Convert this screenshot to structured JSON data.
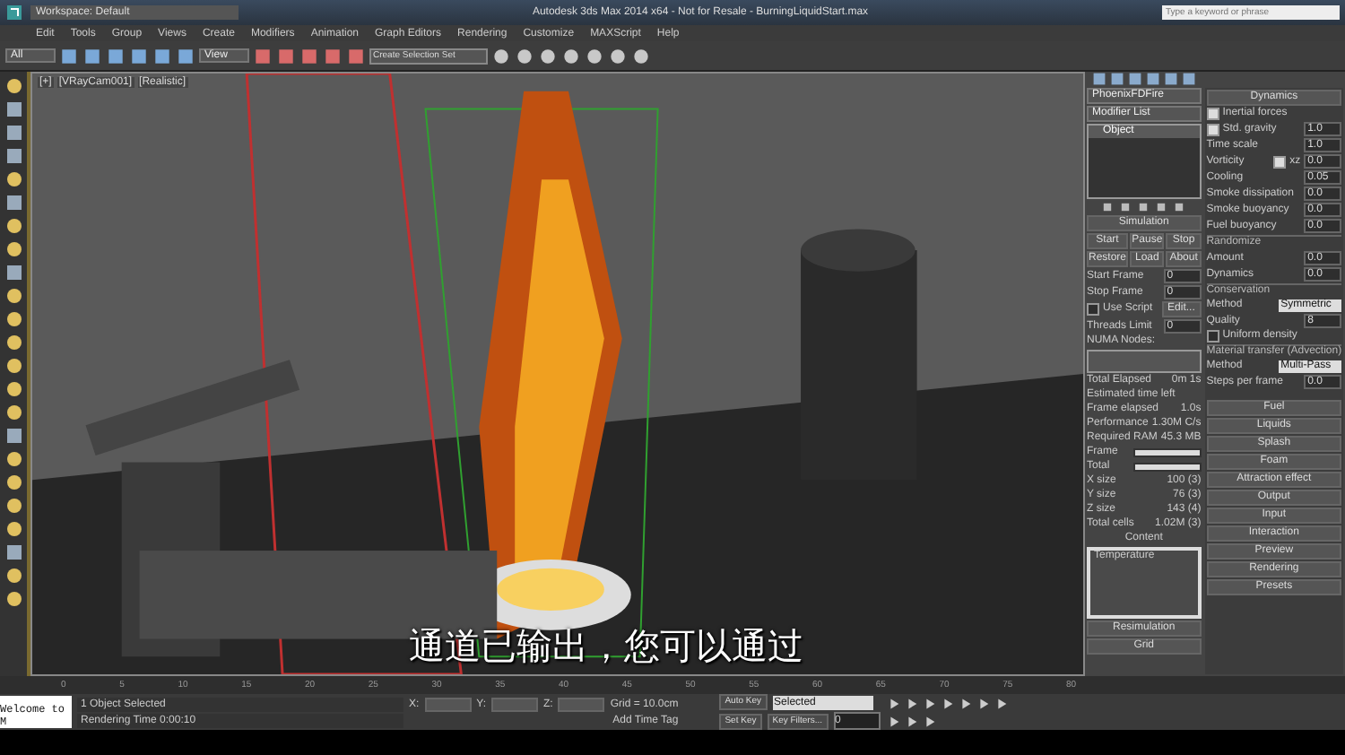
{
  "title_bar": {
    "workspace": "Workspace: Default",
    "title": "Autodesk 3ds Max 2014 x64 - Not for Resale - BurningLiquidStart.max",
    "search": {
      "placeholder": "Type a keyword or phrase"
    }
  },
  "menu": [
    "Edit",
    "Tools",
    "Group",
    "Views",
    "Create",
    "Modifiers",
    "Animation",
    "Graph Editors",
    "Rendering",
    "Customize",
    "MAXScript",
    "Help"
  ],
  "toolbar": {
    "selection_filter": "All",
    "reference_coord": "View",
    "selection_set": {
      "placeholder": "Create Selection Set"
    }
  },
  "viewport": {
    "labels": [
      "[+]",
      "[VRayCam001]",
      "[Realistic]"
    ],
    "subtitle": "通道已输出，您可以通过"
  },
  "modify_panel": {
    "object_name": "PhoenixFDFire",
    "modifier_list": "Modifier List",
    "stack": [
      {
        "label": "Object",
        "selected": true
      }
    ]
  },
  "simulation": {
    "title": "Simulation",
    "buttons": [
      "Start",
      "Pause",
      "Stop",
      "Restore",
      "Load",
      "About"
    ],
    "frames": [
      {
        "label": "Start Frame",
        "value": "0"
      },
      {
        "label": "Stop Frame",
        "value": "0"
      }
    ],
    "use_script": {
      "label": "Use Script",
      "checked": false
    },
    "edit_button": "Edit...",
    "threads": {
      "label": "Threads Limit",
      "value": "0"
    },
    "numa_label": "NUMA Nodes:",
    "stats": [
      {
        "label": "Total Elapsed",
        "value": "0m 1s"
      },
      {
        "label": "Estimated time left"
      },
      {
        "label": "Frame elapsed",
        "value": "1.0s"
      },
      {
        "label": "Performance",
        "value": "1.30M C/s"
      },
      {
        "label": "Required RAM",
        "value": "45.3 MB"
      }
    ],
    "progress": [
      {
        "label": "Frame",
        "level": 1
      },
      {
        "label": "Total",
        "level": 1
      }
    ],
    "sizes": [
      {
        "label": "X size",
        "value": "100 (3)"
      },
      {
        "label": "Y size",
        "value": "76 (3)"
      },
      {
        "label": "Z size",
        "value": "143 (4)"
      },
      {
        "label": "Total cells",
        "value": "1.02M (3)"
      }
    ],
    "content_label": "Content",
    "content_items": [
      {
        "label": "Temperature",
        "selected": false
      }
    ]
  },
  "panel_rollouts": [
    "Resimulation",
    "Grid"
  ],
  "dynamics": {
    "title": "Dynamics",
    "rows": [
      {
        "kind": "check",
        "label": "Inertial forces",
        "checked": true
      },
      {
        "kind": "check_spin",
        "label": "Std. gravity",
        "checked": true,
        "value": "1.0"
      },
      {
        "kind": "spin",
        "label": "Time scale",
        "value": "1.0"
      },
      {
        "kind": "spin_check",
        "label": "Vorticity",
        "check_label": "xz",
        "checked": true,
        "value": "0.0"
      },
      {
        "kind": "spin",
        "label": "Cooling",
        "value": "0.05"
      },
      {
        "kind": "spin",
        "label": "Smoke dissipation",
        "value": "0.0"
      },
      {
        "kind": "spin",
        "label": "Smoke buoyancy",
        "value": "0.0"
      },
      {
        "kind": "spin",
        "label": "Fuel buoyancy",
        "value": "0.0"
      },
      {
        "kind": "group",
        "label": "Randomize"
      },
      {
        "kind": "spin",
        "label": "Amount",
        "value": "0.0"
      },
      {
        "kind": "spin",
        "label": "Dynamics",
        "value": "0.0"
      },
      {
        "kind": "group",
        "label": "Conservation"
      },
      {
        "kind": "dropdown",
        "label": "Method",
        "value": "Symmetric"
      },
      {
        "kind": "spin",
        "label": "Quality",
        "value": "8"
      },
      {
        "kind": "check",
        "label": "Uniform density",
        "checked": false
      },
      {
        "kind": "group",
        "label": "Material transfer (Advection)"
      },
      {
        "kind": "dropdown",
        "label": "Method",
        "value": "Multi-Pass"
      },
      {
        "kind": "spin",
        "label": "Steps per frame",
        "value": "0.0"
      }
    ]
  },
  "rollouts": [
    "Fuel",
    "Liquids",
    "Splash",
    "Foam",
    "Attraction effect",
    "Output",
    "Input",
    "Interaction",
    "Preview",
    "Rendering",
    "Presets"
  ],
  "timeline": {
    "ticks": [
      "0",
      "5",
      "10",
      "15",
      "20",
      "25",
      "30",
      "35",
      "40",
      "45",
      "50",
      "55",
      "60",
      "65",
      "70",
      "75",
      "80"
    ]
  },
  "status_bar": {
    "listener": "Welcome to M",
    "selection": "1 Object Selected",
    "prompt": "Rendering Time  0:00:10",
    "coords": [
      "X:",
      "Y:",
      "Z:"
    ],
    "grid": "Grid = 10.0cm",
    "time_tag": "Add Time Tag",
    "auto_key": "Auto Key",
    "key_mode": "Selected",
    "set_key": "Set Key",
    "key_filters": "Key Filters...",
    "frame": "0"
  }
}
